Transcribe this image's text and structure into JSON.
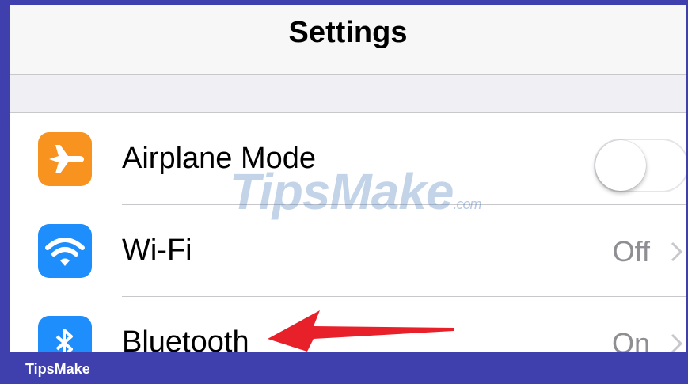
{
  "navbar": {
    "title": "Settings"
  },
  "rows": [
    {
      "label": "Airplane Mode",
      "icon": "airplane-icon",
      "icon_color": "#f7931e",
      "toggle": "off"
    },
    {
      "label": "Wi-Fi",
      "value": "Off",
      "icon": "wifi-icon",
      "icon_color": "#1e8efc"
    },
    {
      "label": "Bluetooth",
      "value": "On",
      "icon": "bluetooth-icon",
      "icon_color": "#1e8efc"
    }
  ],
  "watermark": {
    "main": "TipsMake",
    "suffix": ".com"
  },
  "annotation": {
    "icon": "red-arrow-pointing-left",
    "color": "#e8202a"
  },
  "footer": {
    "brand": "TipsMake"
  },
  "colors": {
    "frame": "#3f3fae",
    "separator": "#c8c7cc",
    "secondary_text": "#8e8e93"
  }
}
